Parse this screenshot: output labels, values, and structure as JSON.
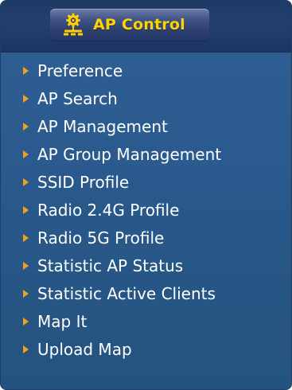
{
  "header": {
    "icon": "gear-network-icon",
    "title": "AP Control",
    "title_color": "#ffd200"
  },
  "menu": {
    "arrow_icon": "triangle-right-icon",
    "arrow_color": "#f3a11d",
    "items": [
      {
        "label": "Preference"
      },
      {
        "label": "AP Search"
      },
      {
        "label": "AP Management"
      },
      {
        "label": "AP Group Management"
      },
      {
        "label": "SSID Profile"
      },
      {
        "label": "Radio 2.4G Profile"
      },
      {
        "label": "Radio 5G Profile"
      },
      {
        "label": "Statistic AP Status"
      },
      {
        "label": "Statistic Active Clients"
      },
      {
        "label": "Map It"
      },
      {
        "label": "Upload Map"
      }
    ]
  },
  "colors": {
    "panel_background": "#2a5a8e",
    "header_background": "#1e3a66",
    "text": "#ffffff"
  }
}
